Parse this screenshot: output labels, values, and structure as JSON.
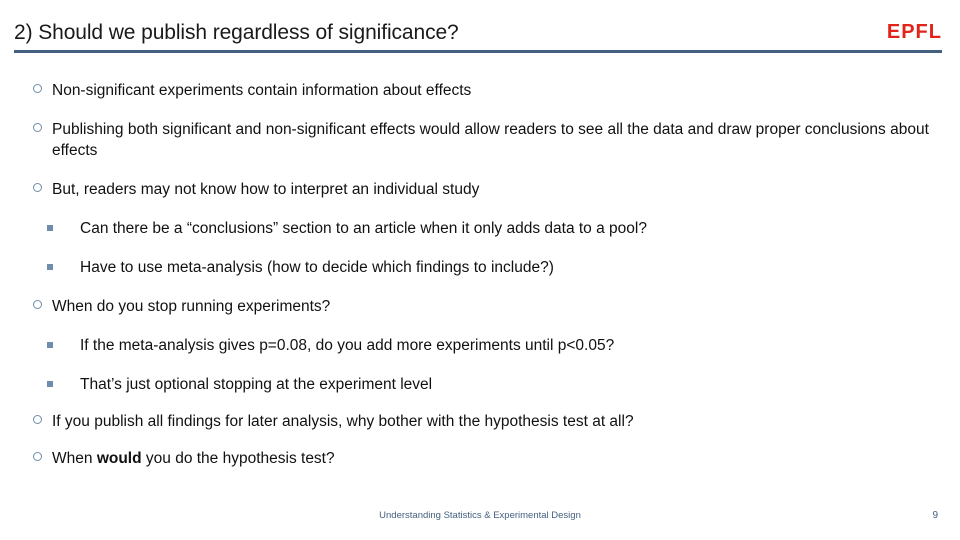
{
  "slide": {
    "title": "2) Should we publish regardless of significance?",
    "logo_text": "EPFL",
    "accent_rule_color": "#44607f",
    "logo_color": "#e2231a",
    "bullet_marker_color": "#6e8cab",
    "bullets": [
      {
        "level": 1,
        "text": "Non-significant experiments contain information about effects"
      },
      {
        "level": 1,
        "text": "Publishing both significant and non-significant effects would allow readers to see all the data and draw proper conclusions about effects"
      },
      {
        "level": 1,
        "text": "But, readers may not know how to interpret an individual study"
      },
      {
        "level": 2,
        "text": "Can there be a “conclusions” section to an article when it only adds data to a pool?"
      },
      {
        "level": 2,
        "text": "Have to use meta-analysis (how to decide which findings to include?)"
      },
      {
        "level": 1,
        "text": "When do you stop running experiments?"
      },
      {
        "level": 2,
        "text": "If the meta-analysis gives p=0.08, do you add more experiments until p<0.05?"
      },
      {
        "level": 2,
        "text": "That’s just optional stopping at the experiment level"
      },
      {
        "level": 1,
        "text": "If you publish all findings for later analysis, why bother with the hypothesis test at all?"
      },
      {
        "level": 1,
        "text_before_bold": "When ",
        "bold_text": "would",
        "text_after_bold": " you do the hypothesis test?"
      }
    ],
    "footer": {
      "caption": "Understanding Statistics & Experimental Design",
      "page_number": "9"
    }
  }
}
